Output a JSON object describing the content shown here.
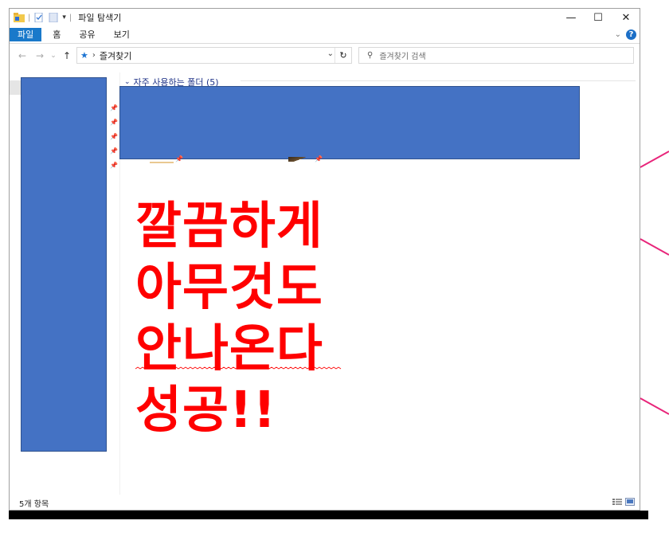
{
  "window": {
    "title": "파일 탐색기",
    "controls": {
      "minimize": "—",
      "maximize": "☐",
      "close": "✕"
    }
  },
  "ribbon": {
    "tabs": [
      "파일",
      "홈",
      "공유",
      "보기"
    ],
    "expand": "⌄",
    "help": "?"
  },
  "address": {
    "back": "←",
    "forward": "→",
    "recent": "⌄",
    "up": "↑",
    "path": "즐겨찾기",
    "refresh": "↻",
    "search_placeholder": "즐겨찾기 검색"
  },
  "content": {
    "group_header": "자주 사용하는 폴더 (5)",
    "overlay_lines": [
      "깔끔하게",
      "아무것도",
      "안나온다",
      "성공!!"
    ]
  },
  "status": {
    "item_count": "5개 항목"
  },
  "colors": {
    "redaction": "#4472c4",
    "overlay_text": "#ff0000",
    "file_tab": "#1979ca",
    "accent_line": "#e8257a"
  },
  "icons": [
    "folder-icon",
    "properties-icon",
    "new-folder-icon",
    "pin-icon",
    "star-icon",
    "search-icon",
    "details-view-icon",
    "large-icons-view-icon"
  ]
}
